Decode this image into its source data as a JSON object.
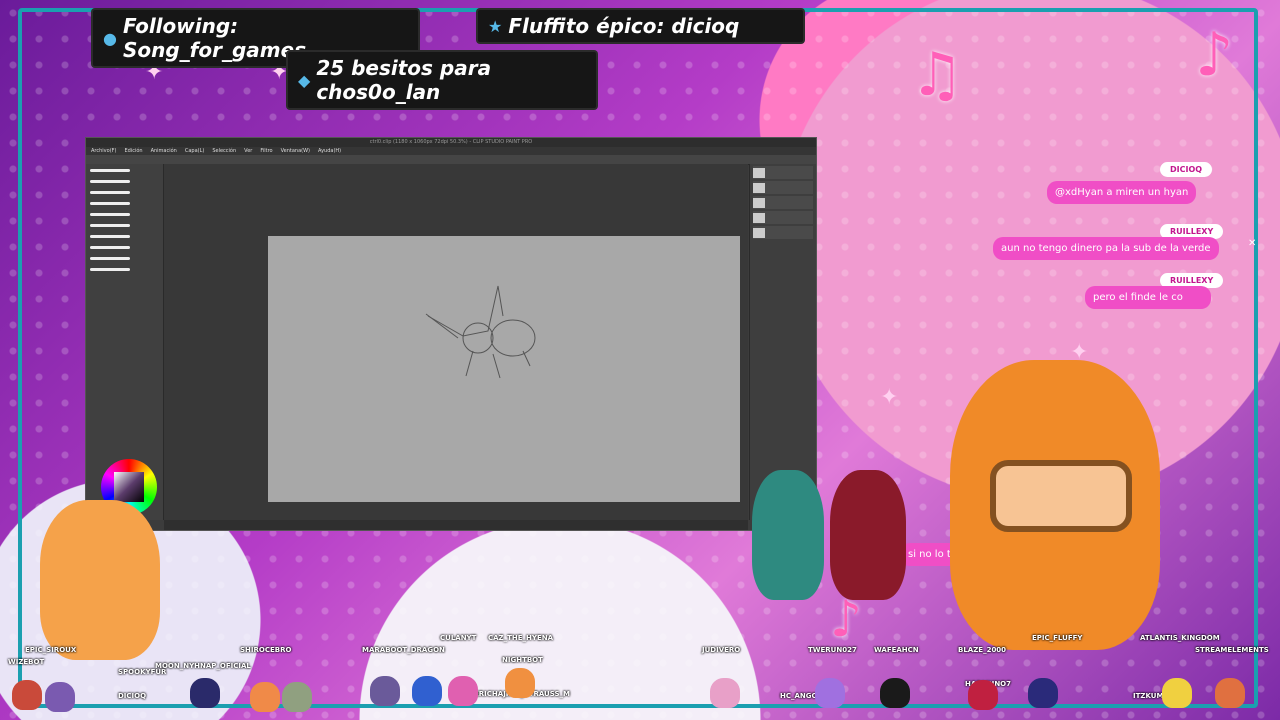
{
  "alerts": {
    "following": "Following: Song_for_games",
    "fluffito": "Fluffito épico: dicioq",
    "besitos": "25 besitos para chos0o_lan"
  },
  "app": {
    "title": "ctrl0.clip (1180 x 1060px 72dpi 50.3%) - CLIP STUDIO PAINT PRO",
    "menu": [
      "Archivo(F)",
      "Edición",
      "Animación",
      "Capa(L)",
      "Selección",
      "Ver",
      "Filtro",
      "Ventana(W)",
      "Ayuda(H)"
    ]
  },
  "chat": {
    "user1": "DICIOQ",
    "msg1_mention": "@xdHyan",
    "msg1_text": "a miren un hyan",
    "user2": "RUILLEXY",
    "msg2": "aun no tengo dinero pa la sub de la verde",
    "user3": "RUILLEXY",
    "msg3": "pero el finde le co",
    "msg4": "si no lo terminas tú"
  },
  "viewers": [
    "EPIC_SIROUX",
    "WIZEBOT",
    "SPOOKYFUR",
    "MOON_NYHNAP_OFICIAL",
    "SHIROCEBRO",
    "MARABOOT_DRAGON",
    "CULANYT",
    "CAZ_THE_HYENA",
    "NIGHTBOT",
    "ERICHAJIME_STRAUSS_M",
    "JUDIVERO",
    "TWERUN027",
    "WAFEAHCN",
    "BLAZE_2000",
    "EPIC_FLUFFY",
    "ATLANTIS_KINGDOM",
    "STREAMELEMENTS",
    "HC_ANGCZZ",
    "HARMUNO7",
    "ITZKUMA",
    "DICIOQ"
  ],
  "colors": {
    "frame": "#1b9fb0",
    "chat_bubble": "#f04ec6",
    "alert_bg": "#161616"
  }
}
